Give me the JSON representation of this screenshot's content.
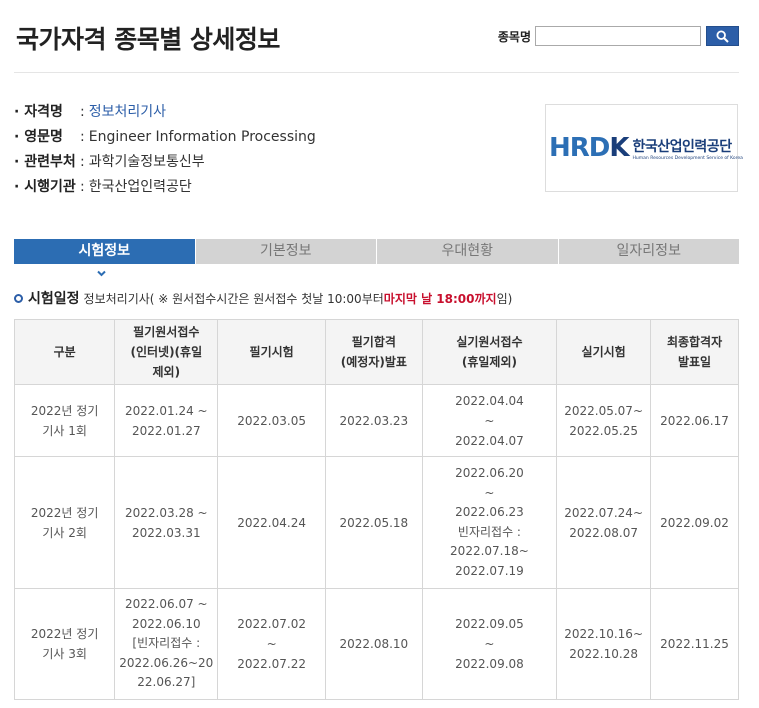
{
  "page": {
    "title": "국가자격 종목별 상세정보"
  },
  "search": {
    "label": "종목명",
    "value": "",
    "placeholder": ""
  },
  "info": {
    "rows": [
      {
        "key": "자격명",
        "sep": ":",
        "value": "정보처리기사"
      },
      {
        "key": "영문명",
        "sep": ":",
        "value": "Engineer Information Processing"
      },
      {
        "key": "관련부처",
        "sep": ":",
        "value": "과학기술정보통신부"
      },
      {
        "key": "시행기관",
        "sep": ":",
        "value": "한국산업인력공단"
      }
    ]
  },
  "logo": {
    "mark_left": "HRD",
    "mark_right": "K",
    "name_ko": "한국산업인력공단",
    "name_en": "Human Resources Development Service of Korea"
  },
  "tabs": [
    {
      "label": "시험정보",
      "active": true
    },
    {
      "label": "기본정보",
      "active": false
    },
    {
      "label": "우대현황",
      "active": false
    },
    {
      "label": "일자리정보",
      "active": false
    }
  ],
  "section": {
    "heading": "시험일정",
    "subject": "정보처리기사",
    "note_prefix": "( ※ 원서접수시간은 원서접수 첫날 10:00부터 ",
    "note_emphasis": "마지막 날 18:00까지",
    "note_suffix": "임)"
  },
  "table": {
    "headers": [
      "구분",
      "필기원서접수\n(인터넷)(휴일\n제외)",
      "필기시험",
      "필기합격\n(예정자)발표",
      "실기원서접수\n(휴일제외)",
      "실기시험",
      "최종합격자\n발표일"
    ],
    "rows": [
      [
        "2022년 정기\n기사 1회",
        "2022.01.24 ~\n2022.01.27",
        "2022.03.05",
        "2022.03.23",
        "2022.04.04\n~\n2022.04.07",
        "2022.05.07~\n2022.05.25",
        "2022.06.17"
      ],
      [
        "2022년 정기\n기사 2회",
        "2022.03.28 ~\n2022.03.31",
        "2022.04.24",
        "2022.05.18",
        "2022.06.20\n~\n2022.06.23\n빈자리접수 :\n2022.07.18~\n2022.07.19",
        "2022.07.24~\n2022.08.07",
        "2022.09.02"
      ],
      [
        "2022년 정기\n기사 3회",
        "2022.06.07 ~\n2022.06.10\n[빈자리접수 :\n2022.06.26~20\n22.06.27]",
        "2022.07.02\n~\n2022.07.22",
        "2022.08.10",
        "2022.09.05\n~\n2022.09.08",
        "2022.10.16~\n2022.10.28",
        "2022.11.25"
      ]
    ]
  },
  "colors": {
    "accent": "#2c6db3",
    "deadline": "#c8102e",
    "tab_inactive": "#d3d3d3"
  }
}
